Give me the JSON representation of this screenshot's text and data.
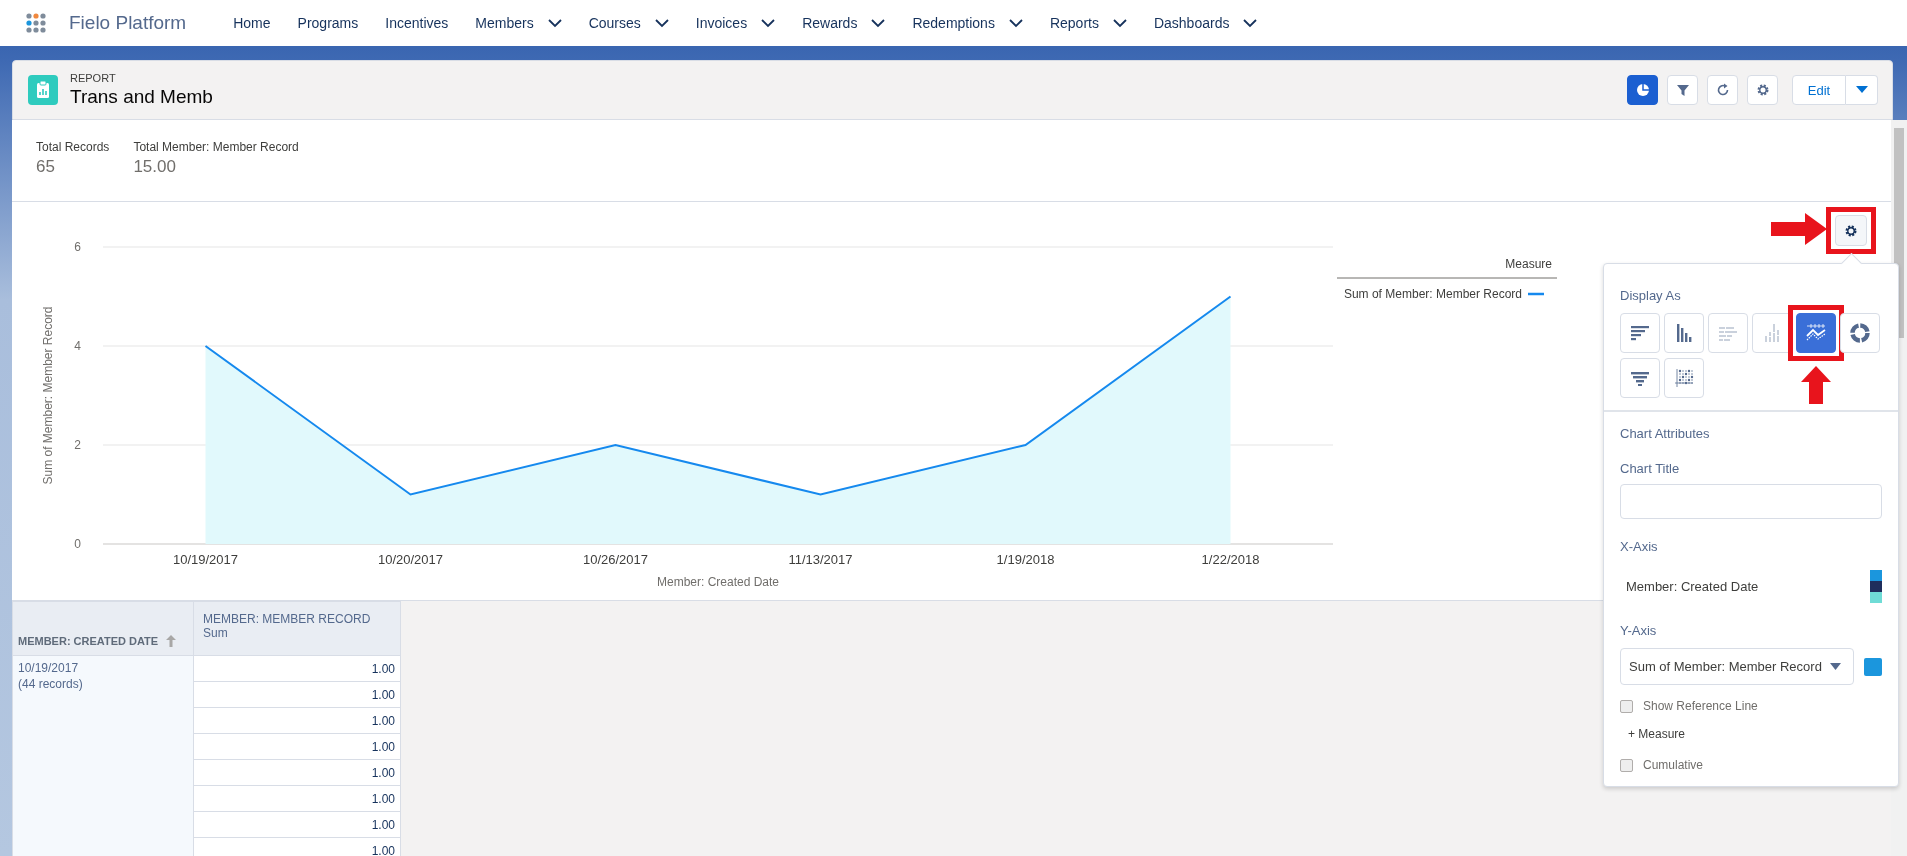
{
  "nav": {
    "app_name": "Fielo Platform",
    "items": [
      {
        "label": "Home",
        "dropdown": false
      },
      {
        "label": "Programs",
        "dropdown": false
      },
      {
        "label": "Incentives",
        "dropdown": false
      },
      {
        "label": "Members",
        "dropdown": true
      },
      {
        "label": "Courses",
        "dropdown": true
      },
      {
        "label": "Invoices",
        "dropdown": true
      },
      {
        "label": "Rewards",
        "dropdown": true
      },
      {
        "label": "Redemptions",
        "dropdown": true
      },
      {
        "label": "Reports",
        "dropdown": true
      },
      {
        "label": "Dashboards",
        "dropdown": true
      }
    ]
  },
  "header": {
    "object_type": "REPORT",
    "title": "Trans and Memb",
    "buttons": [
      {
        "kind": "chart",
        "selected": true
      },
      {
        "kind": "filter",
        "selected": false
      },
      {
        "kind": "refresh",
        "selected": false
      },
      {
        "kind": "settings",
        "selected": false
      }
    ],
    "edit_label": "Edit"
  },
  "summary": [
    {
      "label": "Total Records",
      "value": "65"
    },
    {
      "label": "Total Member: Member Record",
      "value": "15.00"
    }
  ],
  "chart": {
    "legend_title": "Measure",
    "settings_button": {
      "highlighted": true
    },
    "chart_data": {
      "type": "area",
      "xlabel": "Member: Created Date",
      "ylabel": "Sum of Member: Member Record",
      "categories": [
        "10/19/2017",
        "10/20/2017",
        "10/26/2017",
        "11/13/2017",
        "1/19/2018",
        "1/22/2018"
      ],
      "series": [
        {
          "name": "Sum of Member: Member Record",
          "color": "#1589ee",
          "values": [
            4,
            1,
            2,
            1,
            2,
            5
          ]
        }
      ],
      "ylim": [
        0,
        6
      ],
      "yticks": [
        0,
        2,
        4,
        6
      ]
    }
  },
  "chart_settings": {
    "display_as": {
      "title": "Display As",
      "options": [
        {
          "kind": "hbar",
          "selected": false,
          "disabled": false,
          "highlighted": false
        },
        {
          "kind": "vbar",
          "selected": false,
          "disabled": false,
          "highlighted": false
        },
        {
          "kind": "hstacked",
          "selected": false,
          "disabled": true,
          "highlighted": false
        },
        {
          "kind": "vstacked",
          "selected": false,
          "disabled": true,
          "highlighted": false
        },
        {
          "kind": "line",
          "selected": true,
          "disabled": false,
          "highlighted": true
        },
        {
          "kind": "donut",
          "selected": false,
          "disabled": false,
          "highlighted": false
        },
        {
          "kind": "funnel",
          "selected": false,
          "disabled": false,
          "highlighted": false
        },
        {
          "kind": "scatter",
          "selected": false,
          "disabled": false,
          "highlighted": false
        }
      ]
    },
    "attributes_title": "Chart Attributes",
    "chart_title": {
      "label": "Chart Title"
    },
    "x_axis": {
      "label": "X-Axis",
      "value": "Member: Created Date",
      "palette": [
        {
          "color": "#1b96dd"
        },
        {
          "color": "#1f2e5c"
        },
        {
          "color": "#6fdcd6"
        }
      ]
    },
    "y_axis": {
      "label": "Y-Axis",
      "value": "Sum of Member: Member Record",
      "color": "#1b96dd"
    },
    "options": [
      {
        "kind": "checkbox",
        "label": "Show Reference Line",
        "checked": false
      },
      {
        "kind": "link",
        "label": "+ Measure"
      },
      {
        "kind": "checkbox",
        "label": "Cumulative",
        "checked": false
      }
    ]
  },
  "table": {
    "columns": [
      {
        "label": "MEMBER: CREATED DATE",
        "sorted": true
      },
      {
        "label": "MEMBER: MEMBER RECORD",
        "sublabel": "Sum"
      }
    ],
    "groups": [
      {
        "date": "10/19/2017",
        "count": "(44 records)",
        "values": [
          "1.00",
          "1.00",
          "1.00",
          "1.00",
          "1.00",
          "1.00",
          "1.00",
          "1.00"
        ]
      }
    ]
  }
}
